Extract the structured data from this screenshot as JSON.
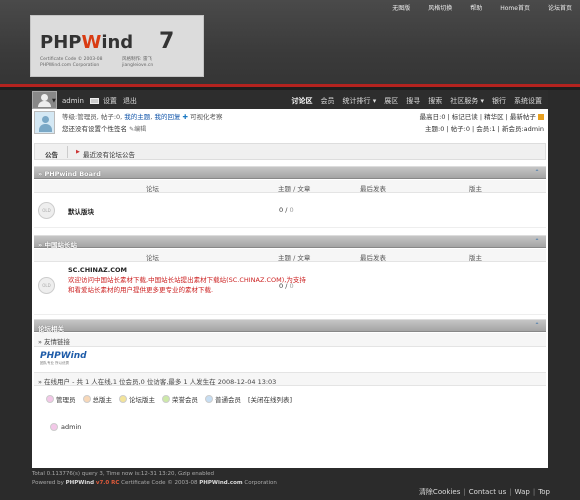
{
  "header": {
    "toplinks": [
      "无图版",
      "风格切换",
      "帮助",
      "Home首页",
      "论坛首页"
    ],
    "logo_pre": "PHP",
    "logo_w": "W",
    "logo_post": "ind",
    "logo_seven": "7",
    "cert_line1": "Certificate Code © 2003-08",
    "cert_line2": "PHPWind.com Corporation",
    "designer_line1": "风格制作: 雷飞",
    "designer_line2": "jiangleiove.cn"
  },
  "nav": {
    "username": "admin",
    "settings": "设置",
    "logout": "退出",
    "items": [
      {
        "label": "讨论区",
        "current": true
      },
      {
        "label": "会员",
        "current": false
      },
      {
        "label": "统计排行 ▾",
        "current": false
      },
      {
        "label": "展区",
        "current": false
      },
      {
        "label": "搜寻",
        "current": false
      },
      {
        "label": "搜索",
        "current": false
      },
      {
        "label": "社区服务 ▾",
        "current": false
      },
      {
        "label": "银行",
        "current": false
      },
      {
        "label": "系统设置",
        "current": false
      }
    ]
  },
  "userinfo": {
    "line1_prefix": "等级:管理员, 帖子:0,",
    "my_topics": "我的主题",
    "my_replies": "我的回复",
    "visual_editor": "可视化考察",
    "signature_hint": "您还没有设置个性签名",
    "edit": "编辑",
    "stats_line1": "最高日:0 | 标记已读 | 精华区 | 最新帖子",
    "stats_line2": "主题:0 | 帖子:0 | 会员:1 | 新会员:admin"
  },
  "notice": {
    "label": "公告",
    "text": "最近没有论坛公告"
  },
  "columns": {
    "forum": "论坛",
    "topics_posts": "主题 / 文章",
    "last_post": "最后发表",
    "moderator": "版主"
  },
  "sections": [
    {
      "title": "» PHPwind Board",
      "forums": [
        {
          "name": "默认版块",
          "desc": "",
          "topics": "0",
          "posts": "0"
        }
      ]
    },
    {
      "title": "» 中国站长站",
      "forums": [
        {
          "name": "SC.CHINAZ.COM",
          "desc": "欢迎访问中国站长素材下载,中国站长站提出素材下载站(SC.CHINAZ.COM),为支持和看爱站长素材的用户提供更多更专业的素材下载.",
          "topics": "0",
          "posts": "0"
        }
      ]
    }
  ],
  "related": {
    "title": "论坛相关",
    "links_label": "» 友情链接",
    "pw_logo_big": "PHPWind",
    "pw_logo_small": "团队专业 所以优秀",
    "online_text": "» 在线用户 - 共 1 人在线,1 位会员,0 位访客,最多 1 人发生在 2008-12-04 13:03",
    "legend": [
      {
        "label": "管理员",
        "color": "#f3c8e8"
      },
      {
        "label": "总版主",
        "color": "#f8d8b8"
      },
      {
        "label": "论坛版主",
        "color": "#f3e49a"
      },
      {
        "label": "荣誉会员",
        "color": "#cde9a8"
      },
      {
        "label": "普通会员",
        "color": "#c7def3"
      }
    ],
    "close_online": "[关闭在线列表]",
    "online_user": "admin",
    "online_user_color": "#f3c8e8"
  },
  "footer": {
    "line1": "Total 0.113776(s) query 3, Time now is:12-31 13:20, Gzip enabled",
    "line2_pre": "Powered by ",
    "line2_brand": "PHPWind",
    "line2_ver": "v7.0 RC",
    "line2_mid": " Certificate Code © 2003-08 ",
    "line2_site": "PHPWind.com",
    "line2_post": " Corporation",
    "links": [
      "清除Cookies",
      "Contact us",
      "Wap",
      "Top"
    ]
  }
}
